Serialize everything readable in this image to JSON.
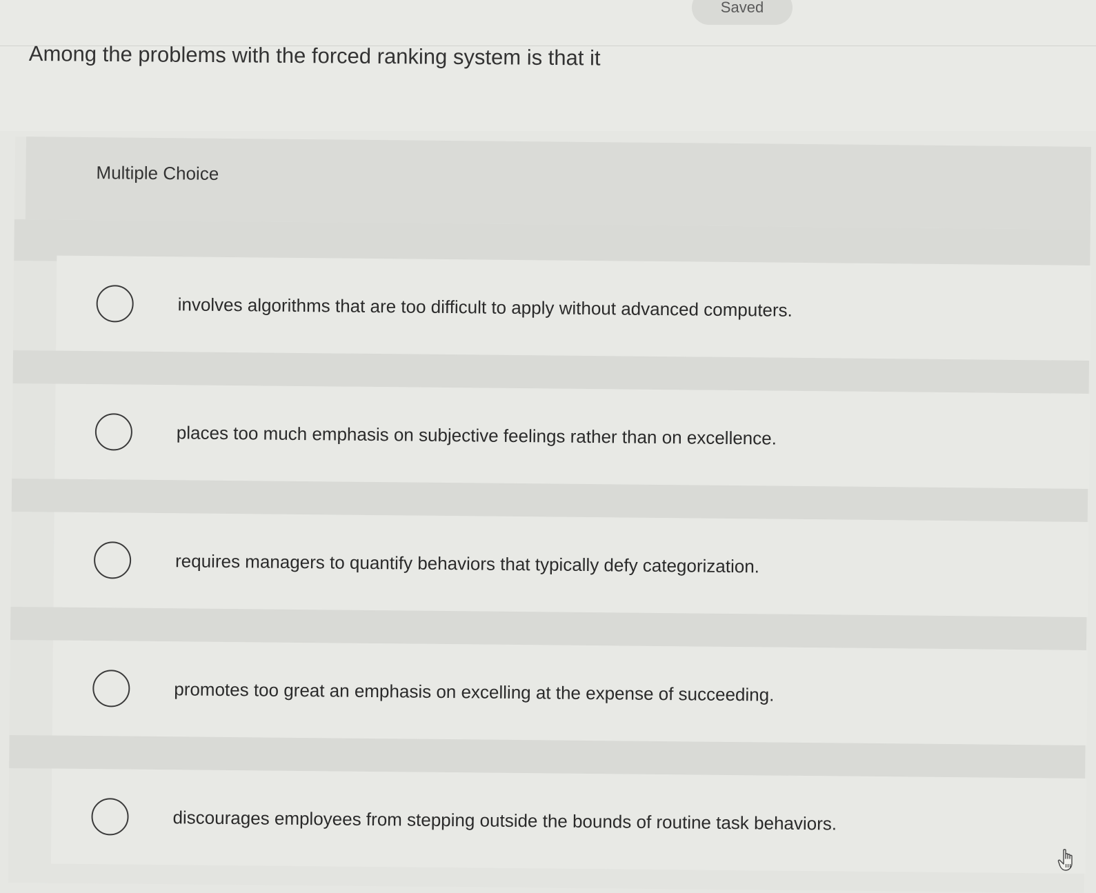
{
  "status": {
    "saved_label": "Saved"
  },
  "question": {
    "prompt": "Among the problems with the forced ranking system is that it",
    "type_label": "Multiple Choice"
  },
  "options": [
    {
      "text": "involves algorithms that are too difficult to apply without advanced computers.",
      "selected": false
    },
    {
      "text": "places too much emphasis on subjective feelings rather than on excellence.",
      "selected": false
    },
    {
      "text": "requires managers to quantify behaviors that typically defy categorization.",
      "selected": false
    },
    {
      "text": "promotes too great an emphasis on excelling at the expense of succeeding.",
      "selected": false
    },
    {
      "text": "discourages employees from stepping outside the bounds of routine task behaviors.",
      "selected": false
    }
  ],
  "icons": {
    "cursor": "hand-pointer-icon"
  }
}
